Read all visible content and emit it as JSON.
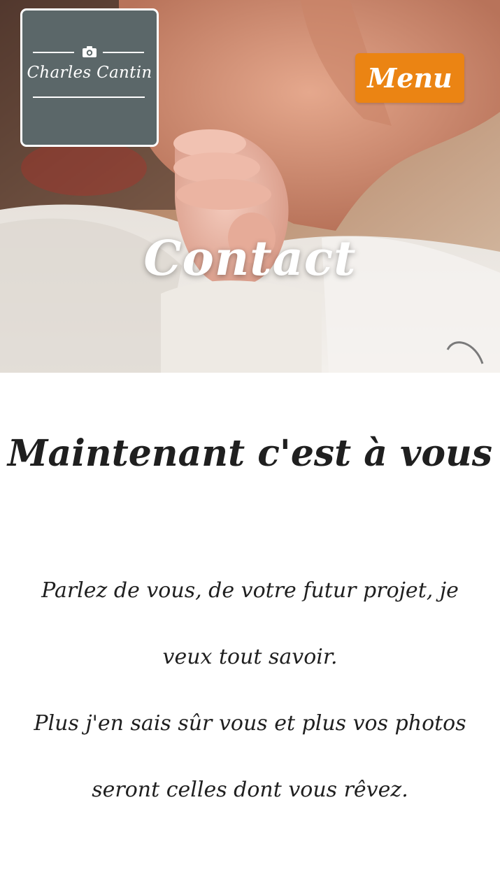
{
  "header": {
    "logo_text": "Charles Cantin",
    "menu_label": "Menu"
  },
  "hero": {
    "title": "Contact"
  },
  "main": {
    "heading": "Maintenant c'est à vous",
    "paragraphs": [
      "Parlez de vous, de votre futur projet, je veux tout savoir.",
      "Plus j'en sais sûr vous et plus vos photos seront celles dont vous rêvez."
    ]
  },
  "colors": {
    "logo_bg": "#5b6769",
    "menu_bg": "#eb8413",
    "text": "#1f1f1f"
  },
  "icons": {
    "logo_icon": "camera-icon"
  }
}
